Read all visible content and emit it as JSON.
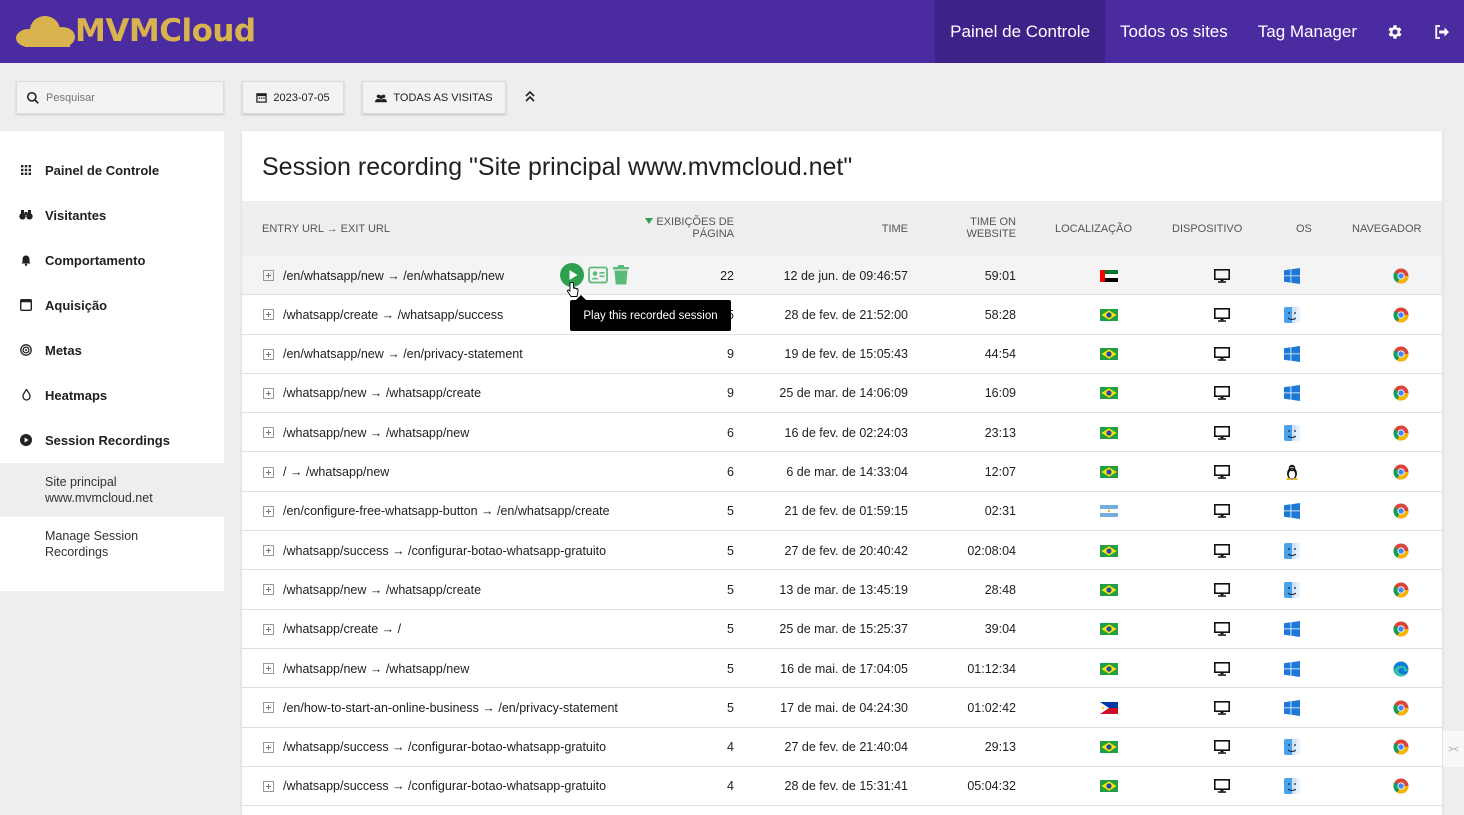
{
  "app": {
    "logo_text": "MVMCloud",
    "brand_color": "#4b2ca0",
    "accent_color": "#d9b34e"
  },
  "nav": {
    "items": [
      {
        "label": "Painel de Controle",
        "active": true
      },
      {
        "label": "Todos os sites"
      },
      {
        "label": "Tag Manager"
      }
    ],
    "settings_icon": "gear-icon",
    "logout_icon": "logout-icon"
  },
  "toolbar": {
    "search_placeholder": "Pesquisar",
    "date_label": "2023-07-05",
    "segment_label": "TODAS AS VISITAS"
  },
  "sidebar": {
    "items": [
      {
        "label": "Painel de Controle",
        "icon": "grid-icon"
      },
      {
        "label": "Visitantes",
        "icon": "binoculars-icon"
      },
      {
        "label": "Comportamento",
        "icon": "bell-icon"
      },
      {
        "label": "Aquisição",
        "icon": "browser-window-icon"
      },
      {
        "label": "Metas",
        "icon": "target-icon"
      },
      {
        "label": "Heatmaps",
        "icon": "flame-icon"
      },
      {
        "label": "Session Recordings",
        "icon": "play-circle-icon"
      }
    ],
    "subitems": [
      {
        "label": "Site principal www.mvmcloud.net",
        "active": true
      },
      {
        "label": "Manage Session Recordings"
      }
    ]
  },
  "main": {
    "title": "Session recording \"Site principal www.mvmcloud.net\"",
    "columns": {
      "url": "ENTRY URL → EXIT URL",
      "pageviews": "EXIBIÇÕES DE PÁGINA",
      "time": "TIME",
      "time_on_website": "TIME ON WEBSITE",
      "location": "LOCALIZAÇÃO",
      "device": "DISPOSITIVO",
      "os": "OS",
      "browser": "NAVEGADOR"
    },
    "tooltip": "Play this recorded session",
    "rows": [
      {
        "url": "/en/whatsapp/new → /en/whatsapp/new",
        "pageviews": "22",
        "time": "12 de jun. de 09:46:57",
        "tow": "59:01",
        "flag": "ae",
        "os": "windows",
        "browser": "chrome"
      },
      {
        "url": "/whatsapp/create → /whatsapp/success",
        "pageviews": "5",
        "time": "28 de fev. de 21:52:00",
        "tow": "58:28",
        "flag": "br",
        "os": "mac",
        "browser": "chrome"
      },
      {
        "url": "/en/whatsapp/new → /en/privacy-statement",
        "pageviews": "9",
        "time": "19 de fev. de 15:05:43",
        "tow": "44:54",
        "flag": "br",
        "os": "windows",
        "browser": "chrome"
      },
      {
        "url": "/whatsapp/new → /whatsapp/create",
        "pageviews": "9",
        "time": "25 de mar. de 14:06:09",
        "tow": "16:09",
        "flag": "br",
        "os": "windows",
        "browser": "chrome"
      },
      {
        "url": "/whatsapp/new → /whatsapp/new",
        "pageviews": "6",
        "time": "16 de fev. de 02:24:03",
        "tow": "23:13",
        "flag": "br",
        "os": "mac",
        "browser": "chrome"
      },
      {
        "url": "/ → /whatsapp/new",
        "pageviews": "6",
        "time": "6 de mar. de 14:33:04",
        "tow": "12:07",
        "flag": "br",
        "os": "linux",
        "browser": "chrome"
      },
      {
        "url": "/en/configure-free-whatsapp-button → /en/whatsapp/create",
        "pageviews": "5",
        "time": "21 de fev. de 01:59:15",
        "tow": "02:31",
        "flag": "ar",
        "os": "windows",
        "browser": "chrome"
      },
      {
        "url": "/whatsapp/success → /configurar-botao-whatsapp-gratuito",
        "pageviews": "5",
        "time": "27 de fev. de 20:40:42",
        "tow": "02:08:04",
        "flag": "br",
        "os": "mac",
        "browser": "chrome"
      },
      {
        "url": "/whatsapp/new → /whatsapp/create",
        "pageviews": "5",
        "time": "13 de mar. de 13:45:19",
        "tow": "28:48",
        "flag": "br",
        "os": "mac",
        "browser": "chrome"
      },
      {
        "url": "/whatsapp/create → /",
        "pageviews": "5",
        "time": "25 de mar. de 15:25:37",
        "tow": "39:04",
        "flag": "br",
        "os": "windows",
        "browser": "chrome"
      },
      {
        "url": "/whatsapp/new → /whatsapp/new",
        "pageviews": "5",
        "time": "16 de mai. de 17:04:05",
        "tow": "01:12:34",
        "flag": "br",
        "os": "windows",
        "browser": "edge"
      },
      {
        "url": "/en/how-to-start-an-online-business → /en/privacy-statement",
        "pageviews": "5",
        "time": "17 de mai. de 04:24:30",
        "tow": "01:02:42",
        "flag": "ph",
        "os": "windows",
        "browser": "chrome"
      },
      {
        "url": "/whatsapp/success → /configurar-botao-whatsapp-gratuito",
        "pageviews": "4",
        "time": "27 de fev. de 21:40:04",
        "tow": "29:13",
        "flag": "br",
        "os": "mac",
        "browser": "chrome"
      },
      {
        "url": "/whatsapp/success → /configurar-botao-whatsapp-gratuito",
        "pageviews": "4",
        "time": "28 de fev. de 15:31:41",
        "tow": "05:04:32",
        "flag": "br",
        "os": "mac",
        "browser": "chrome"
      }
    ]
  }
}
